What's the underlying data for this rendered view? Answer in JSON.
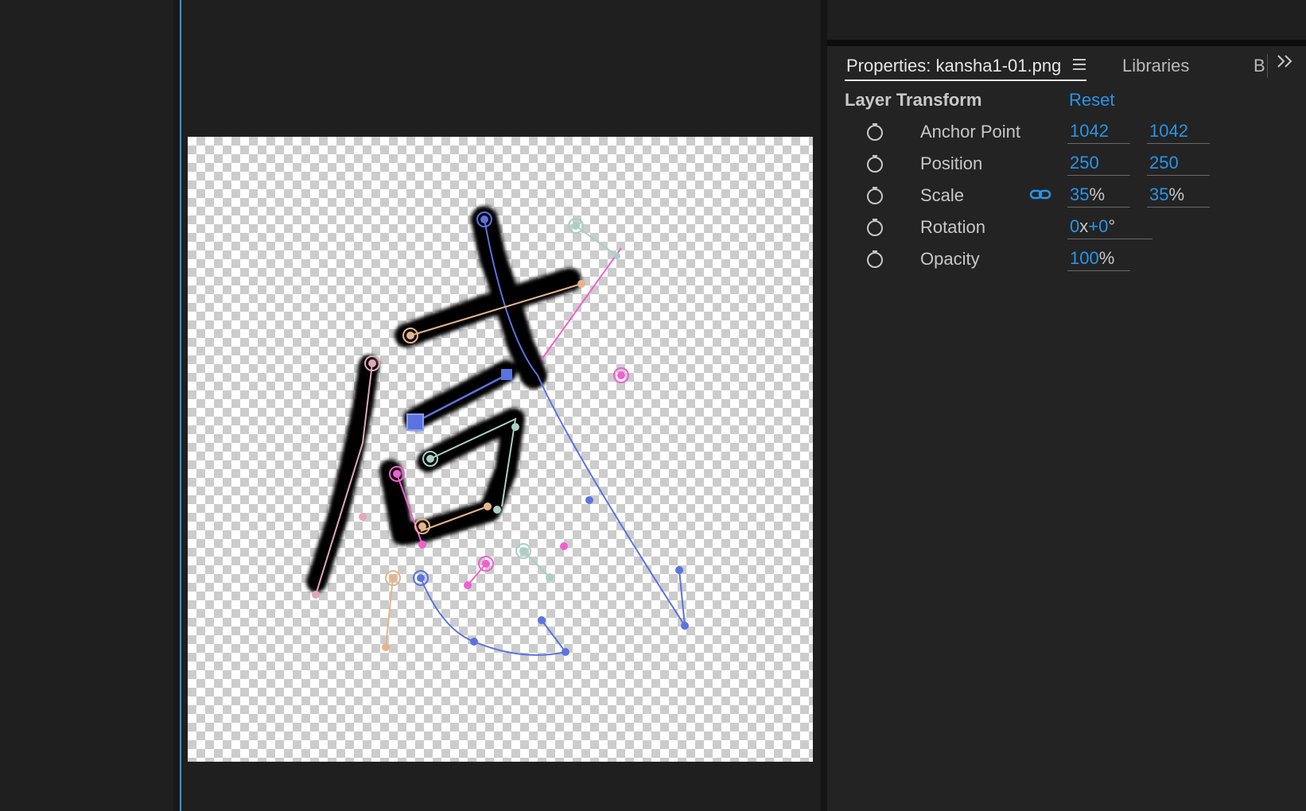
{
  "panel": {
    "tabs": [
      {
        "label": "Properties: kansha1-01.png",
        "active": true
      },
      {
        "label": "Libraries",
        "active": false
      },
      {
        "label": "B",
        "active": false
      }
    ],
    "menu_icon": "hamburger-menu-icon",
    "more_icon": "double-chevron-right-icon",
    "section": {
      "title": "Layer Transform",
      "reset_label": "Reset"
    },
    "properties": [
      {
        "label": "Anchor Point",
        "x": "1042",
        "y": "1042"
      },
      {
        "label": "Position",
        "x": "250",
        "y": "250"
      },
      {
        "label": "Scale",
        "x": "35",
        "y": "35",
        "unit": "%",
        "constrain_icon": "link-icon"
      },
      {
        "label": "Rotation",
        "revolutions": "0",
        "times": "x",
        "degrees": "+0",
        "unit": "°"
      },
      {
        "label": "Opacity",
        "value": "100",
        "unit": "%"
      }
    ],
    "stopwatch_icon": "stopwatch-icon"
  },
  "colors": {
    "accent_blue": "#2b94e6",
    "viewer_border": "#2e9bd6",
    "pin_blue": "#5b73e0",
    "pin_peach": "#e6b48a",
    "pin_teal": "#a8d0c4",
    "pin_pink": "#f060d0",
    "pin_rose": "#e0a8b8"
  },
  "viewer": {
    "image": "kansha1-01.png",
    "content": "brush-stroke character with puppet pins"
  }
}
